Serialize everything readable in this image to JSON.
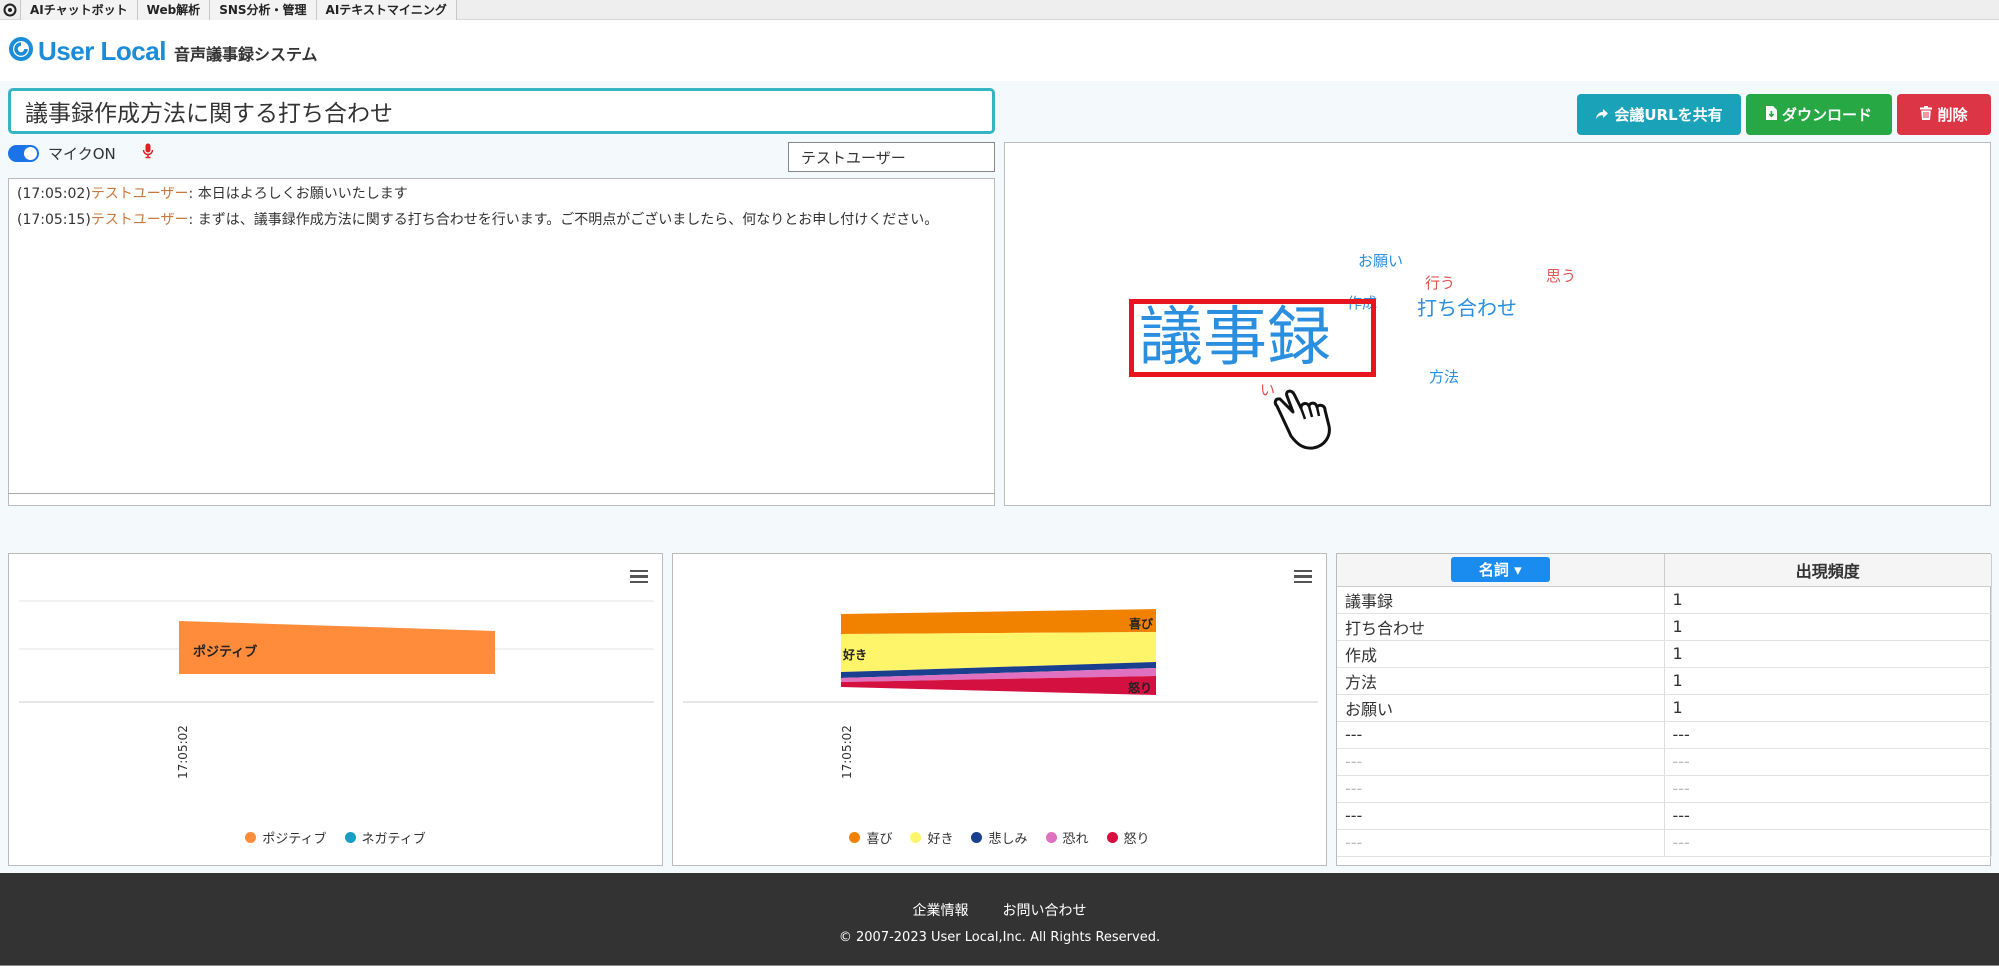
{
  "topbar": {
    "services": [
      "AIチャットボット",
      "Web解析",
      "SNS分析・管理",
      "AIテキストマイニング"
    ]
  },
  "header": {
    "brand": "User Local",
    "system_name": "音声議事録システム"
  },
  "meeting": {
    "title": "議事録作成方法に関する打ち合わせ"
  },
  "actions": {
    "share_label": "会議URLを共有",
    "download_label": "ダウンロード",
    "delete_label": "削除"
  },
  "mic": {
    "label": "マイクON",
    "enabled": true
  },
  "speaker_select": {
    "value": "テストユーザー"
  },
  "transcript": [
    {
      "time": "(17:05:02)",
      "speaker": "テストユーザー",
      "text": ": 本日はよろしくお願いいたします"
    },
    {
      "time": "(17:05:15)",
      "speaker": "テストユーザー",
      "text": ": まずは、議事録作成方法に関する打ち合わせを行います。ご不明点がございましたら、何なりとお申し付けください。"
    }
  ],
  "word_cloud": {
    "words": [
      {
        "text": "議事録",
        "color": "#2b8fe0",
        "highlighted": true
      },
      {
        "text": "打ち合わせ",
        "color": "#2b8fe0"
      },
      {
        "text": "お願い",
        "color": "#2b8fe0"
      },
      {
        "text": "作成",
        "color": "#2b8fe0"
      },
      {
        "text": "方法",
        "color": "#2b8fe0"
      },
      {
        "text": "行う",
        "color": "#e05555"
      },
      {
        "text": "思う",
        "color": "#e05555"
      },
      {
        "text": "い",
        "color": "#e05555"
      }
    ],
    "highlight_color": "#e8141e"
  },
  "chart_data": [
    {
      "type": "area",
      "x": [
        "17:05:02"
      ],
      "series": [
        {
          "name": "ポジティブ",
          "color": "#ff8c3a",
          "values": [
            1
          ]
        },
        {
          "name": "ネガティブ",
          "color": "#1a9dc4",
          "values": [
            0
          ]
        }
      ],
      "legend": "bottom"
    },
    {
      "type": "area",
      "x": [
        "17:05:02"
      ],
      "series": [
        {
          "name": "喜び",
          "color": "#f08200"
        },
        {
          "name": "好き",
          "color": "#fff56a"
        },
        {
          "name": "悲しみ",
          "color": "#1a3f8e"
        },
        {
          "name": "恐れ",
          "color": "#e070c0"
        },
        {
          "name": "怒り",
          "color": "#d41040"
        }
      ],
      "legend": "bottom"
    }
  ],
  "frequency": {
    "noun_button": "名詞",
    "col_freq": "出現頻度",
    "rows": [
      {
        "word": "議事録",
        "count": "1"
      },
      {
        "word": "打ち合わせ",
        "count": "1"
      },
      {
        "word": "作成",
        "count": "1"
      },
      {
        "word": "方法",
        "count": "1"
      },
      {
        "word": "お願い",
        "count": "1"
      },
      {
        "word": "---",
        "count": "---",
        "dim": false
      },
      {
        "word": "---",
        "count": "---",
        "dim": true
      },
      {
        "word": "---",
        "count": "---",
        "dim": true
      },
      {
        "word": "---",
        "count": "---",
        "dim": false
      },
      {
        "word": "---",
        "count": "---",
        "dim": true
      }
    ]
  },
  "footer": {
    "links": [
      "企業情報",
      "お問い合わせ"
    ],
    "copyright": "© 2007-2023 User Local,Inc. All Rights Reserved."
  }
}
